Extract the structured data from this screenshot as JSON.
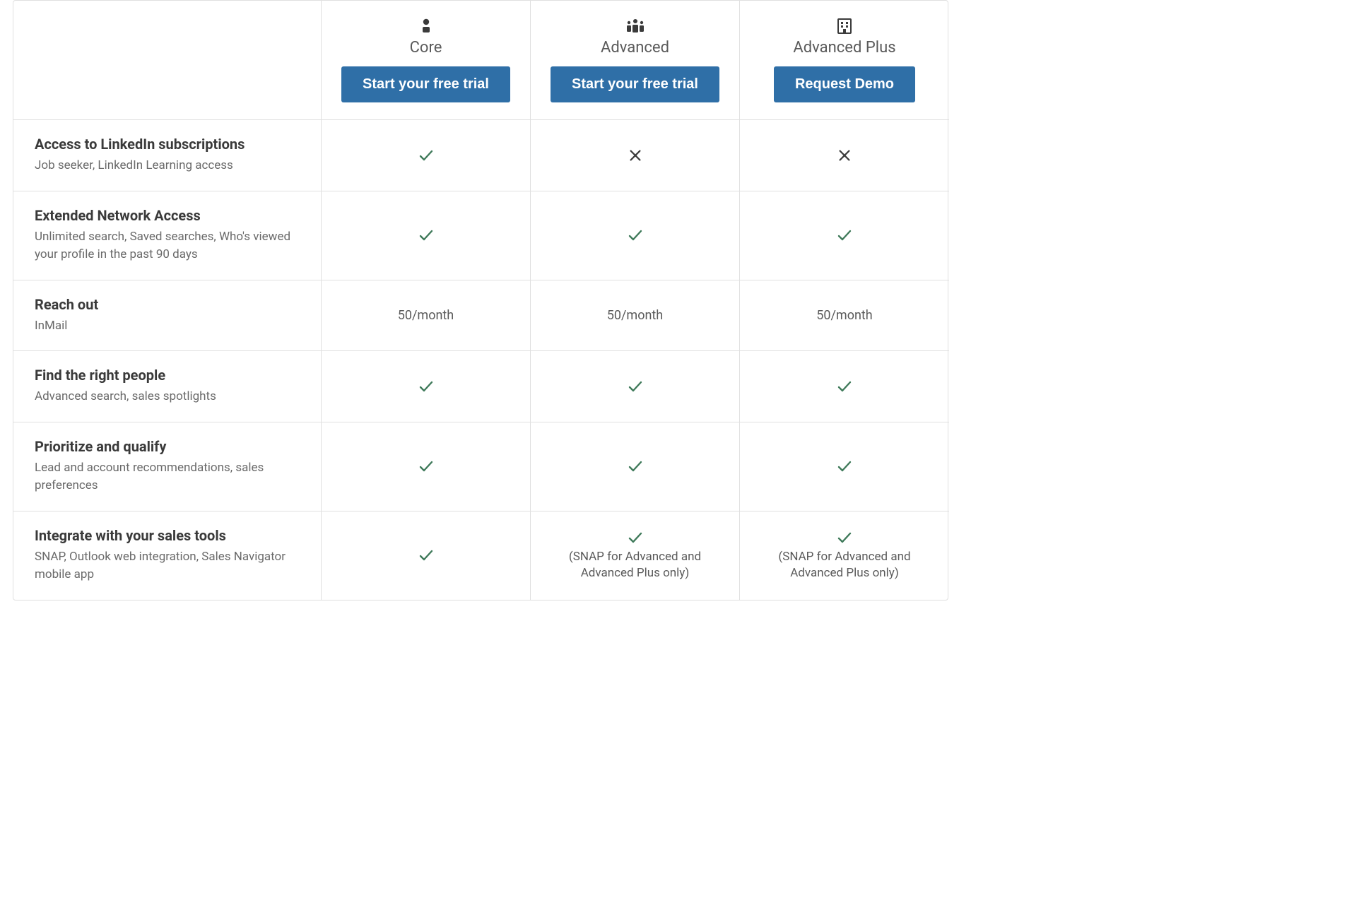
{
  "plans": [
    {
      "name": "Core",
      "icon": "person-icon",
      "cta": "Start your free trial"
    },
    {
      "name": "Advanced",
      "icon": "people-icon",
      "cta": "Start your free trial"
    },
    {
      "name": "Advanced Plus",
      "icon": "building-icon",
      "cta": "Request Demo"
    }
  ],
  "features": [
    {
      "title": "Access to LinkedIn subscriptions",
      "sub": "Job seeker, LinkedIn Learning access",
      "values": [
        {
          "type": "check"
        },
        {
          "type": "x"
        },
        {
          "type": "x"
        }
      ]
    },
    {
      "title": "Extended Network Access",
      "sub": "Unlimited search, Saved searches, Who's viewed your profile in the past 90 days",
      "values": [
        {
          "type": "check"
        },
        {
          "type": "check"
        },
        {
          "type": "check"
        }
      ]
    },
    {
      "title": "Reach out",
      "sub": "InMail",
      "values": [
        {
          "type": "text",
          "text": "50/month"
        },
        {
          "type": "text",
          "text": "50/month"
        },
        {
          "type": "text",
          "text": "50/month"
        }
      ]
    },
    {
      "title": "Find the right people",
      "sub": "Advanced search, sales spotlights",
      "values": [
        {
          "type": "check"
        },
        {
          "type": "check"
        },
        {
          "type": "check"
        }
      ]
    },
    {
      "title": "Prioritize and qualify",
      "sub": "Lead and account recommendations, sales preferences",
      "values": [
        {
          "type": "check"
        },
        {
          "type": "check"
        },
        {
          "type": "check"
        }
      ]
    },
    {
      "title": "Integrate with your sales tools",
      "sub": "SNAP, Outlook web integration, Sales Navigator mobile app",
      "values": [
        {
          "type": "check"
        },
        {
          "type": "check-note",
          "note": "(SNAP for Advanced and Advanced Plus only)"
        },
        {
          "type": "check-note",
          "note": "(SNAP for Advanced and Advanced Plus only)"
        }
      ]
    }
  ],
  "colors": {
    "accent": "#2f6fa7",
    "check": "#3f7a5a"
  }
}
